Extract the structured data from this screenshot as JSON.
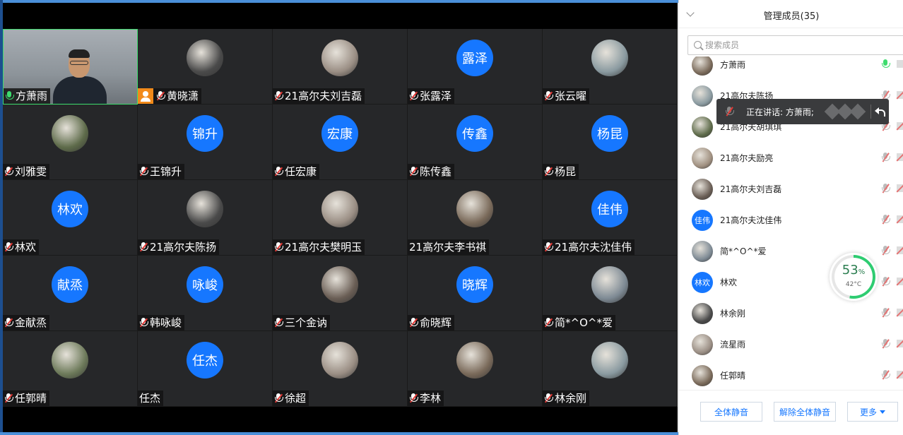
{
  "panel": {
    "title": "管理成员(35)",
    "search_placeholder": "搜索成员",
    "footer": {
      "mute_all": "全体静音",
      "unmute_all": "解除全体静音",
      "more": "更多"
    }
  },
  "speaking_tip": {
    "text": "正在讲话: 方萧雨;"
  },
  "perf": {
    "percent": "53",
    "unit": "%",
    "temp": "42°C",
    "level": 0.53
  },
  "tiles": [
    {
      "name": "方萧雨",
      "mic": "on",
      "avatar_type": "camera"
    },
    {
      "name": "黄晓潇",
      "mic": "muted",
      "avatar_type": "photo",
      "host": true
    },
    {
      "name": "21高尔夫刘吉磊",
      "mic": "muted",
      "avatar_type": "photo"
    },
    {
      "name": "张露泽",
      "mic": "muted",
      "avatar_type": "blue",
      "initials": "露泽"
    },
    {
      "name": "张云曜",
      "mic": "muted",
      "avatar_type": "photo"
    },
    {
      "name": "刘雅雯",
      "mic": "muted",
      "avatar_type": "photo"
    },
    {
      "name": "王锦升",
      "mic": "muted",
      "avatar_type": "blue",
      "initials": "锦升"
    },
    {
      "name": "任宏康",
      "mic": "muted",
      "avatar_type": "blue",
      "initials": "宏康"
    },
    {
      "name": "陈传鑫",
      "mic": "muted",
      "avatar_type": "blue",
      "initials": "传鑫"
    },
    {
      "name": "杨昆",
      "mic": "muted",
      "avatar_type": "blue",
      "initials": "杨昆"
    },
    {
      "name": "林欢",
      "mic": "muted",
      "avatar_type": "blue",
      "initials": "林欢"
    },
    {
      "name": "21高尔夫陈扬",
      "mic": "muted",
      "avatar_type": "photo"
    },
    {
      "name": "21高尔夫樊明玉",
      "mic": "muted",
      "avatar_type": "photo"
    },
    {
      "name": "21高尔夫李书祺",
      "mic": "none",
      "avatar_type": "photo"
    },
    {
      "name": "21高尔夫沈佳伟",
      "mic": "muted",
      "avatar_type": "blue",
      "initials": "佳伟"
    },
    {
      "name": "金献烝",
      "mic": "muted",
      "avatar_type": "blue",
      "initials": "献烝"
    },
    {
      "name": "韩咏峻",
      "mic": "muted",
      "avatar_type": "blue",
      "initials": "咏峻"
    },
    {
      "name": "三个金讷",
      "mic": "muted",
      "avatar_type": "photo"
    },
    {
      "name": "俞晓辉",
      "mic": "muted",
      "avatar_type": "blue",
      "initials": "晓辉"
    },
    {
      "name": "简*^O^*爱",
      "mic": "muted",
      "avatar_type": "photo"
    },
    {
      "name": "任郭晴",
      "mic": "muted",
      "avatar_type": "photo"
    },
    {
      "name": "任杰",
      "mic": "none",
      "avatar_type": "blue",
      "initials": "任杰"
    },
    {
      "name": "徐超",
      "mic": "muted",
      "avatar_type": "photo"
    },
    {
      "name": "李林",
      "mic": "muted",
      "avatar_type": "photo"
    },
    {
      "name": "林余刚",
      "mic": "muted",
      "avatar_type": "photo"
    }
  ],
  "members": [
    {
      "name": "方萧雨",
      "mic": "on",
      "avatar_type": "photo"
    },
    {
      "name": "21高尔夫陈扬",
      "mic": "muted",
      "avatar_type": "photo"
    },
    {
      "name": "21高尔夫胡琪琪",
      "mic": "muted",
      "avatar_type": "photo"
    },
    {
      "name": "21高尔夫励亮",
      "mic": "muted",
      "avatar_type": "photo"
    },
    {
      "name": "21高尔夫刘吉磊",
      "mic": "muted",
      "avatar_type": "photo"
    },
    {
      "name": "21高尔夫沈佳伟",
      "mic": "muted",
      "avatar_type": "blue",
      "initials": "佳伟"
    },
    {
      "name": "简*^O^*爱",
      "mic": "muted",
      "avatar_type": "photo"
    },
    {
      "name": "林欢",
      "mic": "muted",
      "avatar_type": "blue",
      "initials": "林欢"
    },
    {
      "name": "林余刚",
      "mic": "muted",
      "avatar_type": "photo"
    },
    {
      "name": "流星雨",
      "mic": "muted",
      "avatar_type": "photo"
    },
    {
      "name": "任郭晴",
      "mic": "muted",
      "avatar_type": "photo"
    }
  ],
  "colors": {
    "accent": "#1677ff",
    "speaking": "#3ddc6d",
    "muted": "#e53935",
    "host": "#f28a1a"
  },
  "icons": {
    "mic": "microphone-icon",
    "search": "search-icon",
    "collapse": "chevron-down-icon",
    "reply": "reply-icon",
    "host": "host-user-icon",
    "camera": "camera-icon"
  }
}
